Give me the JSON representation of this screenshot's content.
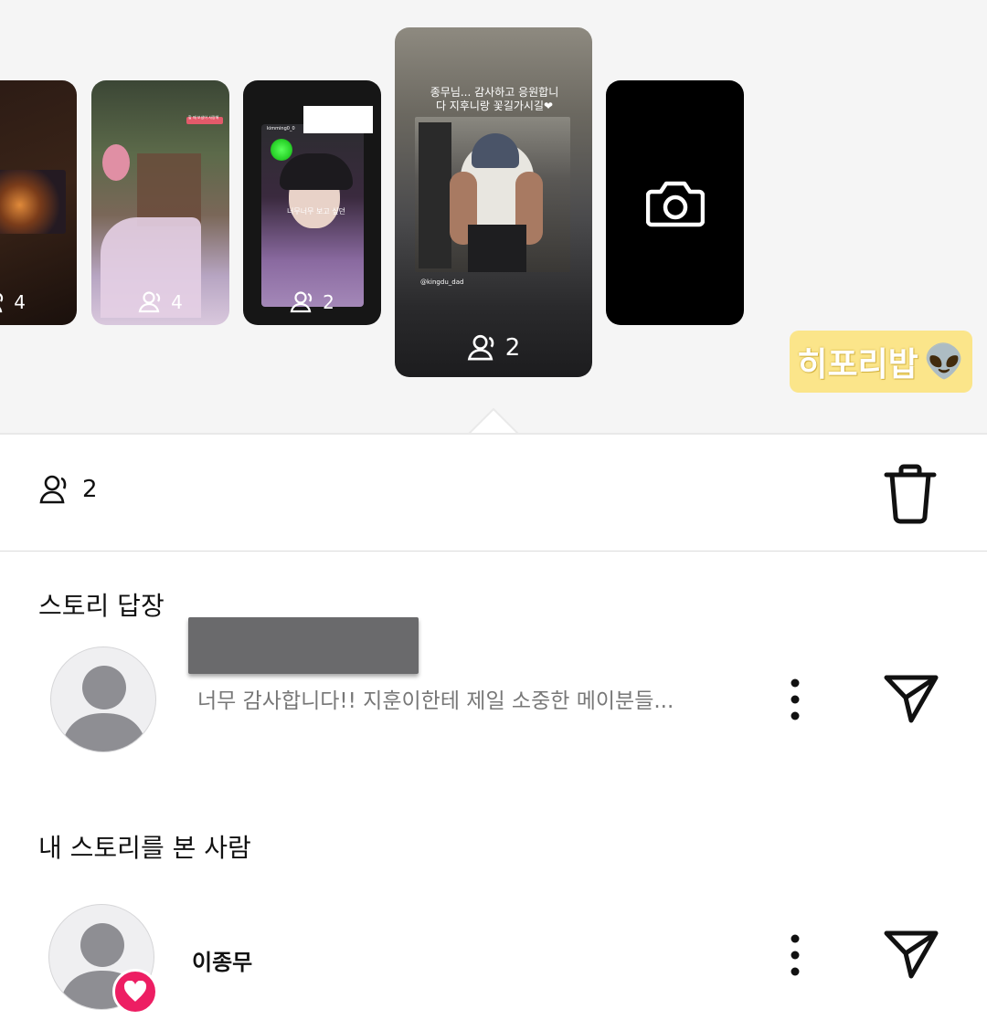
{
  "stories": [
    {
      "viewers": "4"
    },
    {
      "viewers": "4",
      "overlay_text": "할 때 보냈어 사랑해"
    },
    {
      "viewers": "2",
      "overlay_username": "kimming0_0",
      "overlay_caption": "너무너무 보고 싶던"
    },
    {
      "viewers": "2",
      "caption": "종무님... 감사하고 응원합니다 지후니랑 꽃길가시길❤",
      "tag": "@kingdu_dad"
    },
    {
      "type": "camera",
      "icon": "camera-icon"
    }
  ],
  "sticker": {
    "label": "히포리밥",
    "emoji": "👽"
  },
  "header": {
    "viewer_count": "2",
    "delete_icon": "trash-icon"
  },
  "replies": {
    "title": "스토리 답장",
    "items": [
      {
        "message": "너무 감사합니다!! 지훈이한테 제일 소중한 메이분들..."
      }
    ]
  },
  "viewers_section": {
    "title": "내 스토리를 본 사람",
    "items": [
      {
        "name": "이종무",
        "reaction": "heart"
      }
    ]
  },
  "colors": {
    "heart_badge": "#ed1e63",
    "sticker_bg": "#fbe58a",
    "strip_bg": "#f5f5f5"
  }
}
